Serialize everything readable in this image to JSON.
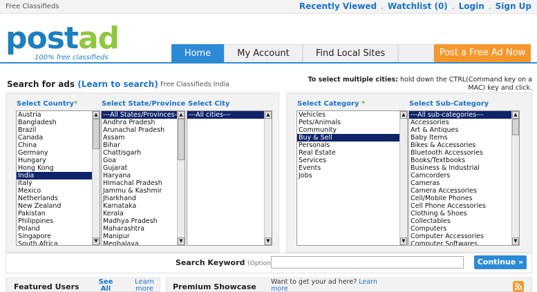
{
  "topbar": {
    "site_label": "Free Classifieds",
    "recently_viewed": "Recently Viewed",
    "watchlist": "Watchlist",
    "watchlist_count": "(0)",
    "login": "Login",
    "signup": "Sign Up",
    "separator": "."
  },
  "logo": {
    "word_part1": "post",
    "word_part2": "ad",
    "tagline": "100% free classifieds"
  },
  "nav": {
    "tabs": [
      {
        "label": "Home",
        "active": true
      },
      {
        "label": "My Account",
        "active": false
      },
      {
        "label": "Find Local Sites",
        "active": false
      },
      {
        "label": "",
        "active": false
      }
    ],
    "post_button": "Post a Free Ad Now"
  },
  "search": {
    "title": "Search for ads",
    "learn_link": "(Learn to search)",
    "subtitle": "Free Classifieds India",
    "multi_note_bold": "To select multiple cities:",
    "multi_note_text": " hold down the CTRL(Command key on a MAC) key and click."
  },
  "filters": {
    "country": {
      "label": "Select Country",
      "required_mark": "*",
      "options": [
        "Austria",
        "Bangladesh",
        "Brazil",
        "Canada",
        "China",
        "Germany",
        "Hungary",
        "Hong Kong",
        "India",
        "Italy",
        "Mexico",
        "Netherlands",
        "New Zealand",
        "Pakistan",
        "Philippines",
        "Poland",
        "Singapore",
        "South Africa"
      ],
      "selected": "India"
    },
    "state": {
      "label": "Select State/Province",
      "options": [
        "---All States/Provinces---",
        "Andhra Pradesh",
        "Arunachal Pradesh",
        "Assam",
        "Bihar",
        "Chattisgarh",
        "Goa",
        "Gujarat",
        "Haryana",
        "Himachal Pradesh",
        "Jammu & Kashmir",
        "Jharkhand",
        "Karnataka",
        "Kerala",
        "Madhya Pradesh",
        "Maharashtra",
        "Manipur",
        "Meghalaya"
      ],
      "selected": "---All States/Provinces---"
    },
    "city": {
      "label": "Select City",
      "options": [
        "---All cities---"
      ],
      "selected": "---All cities---"
    },
    "category": {
      "label": "Select Category",
      "required_mark": "*",
      "options": [
        "Vehicles",
        "Pets/Animals",
        "Community",
        "Buy & Sell",
        "Personals",
        "Real Estate",
        "Services",
        "Events",
        "Jobs"
      ],
      "selected": "Buy & Sell"
    },
    "subcategory": {
      "label": "Select Sub-Category",
      "options": [
        "---All sub-categories---",
        "Accessories",
        "Art & Antiques",
        "Baby Items",
        "Bikes & Accessories",
        "Bluetooth Accessories",
        "Books/Textbooks",
        "Business & Industrial",
        "Camcorders",
        "Cameras",
        "Camera Accessories",
        "Cell/Mobile Phones",
        "Cell Phone Accessories",
        "Clothing & Shoes",
        "Collectables",
        "Computers",
        "Computer Accessories",
        "Computer Softwares"
      ],
      "selected": "---All sub-categories---"
    }
  },
  "keyword": {
    "label": "Search Keyword",
    "optional": "(Optional)",
    "value": "",
    "placeholder": "",
    "continue_button": "Continue »"
  },
  "bottom": {
    "featured_title": "Featured Users",
    "see_all": "See All",
    "learn_more": "Learn more",
    "premium_title": "Premium Showcase",
    "premium_note": "Want to get your ad here?",
    "premium_learn": "Learn more"
  },
  "colors": {
    "brand_blue": "#2d8ad6",
    "brand_green": "#8fc73e",
    "accent_orange": "#f4972c",
    "selection_navy": "#10246a"
  }
}
